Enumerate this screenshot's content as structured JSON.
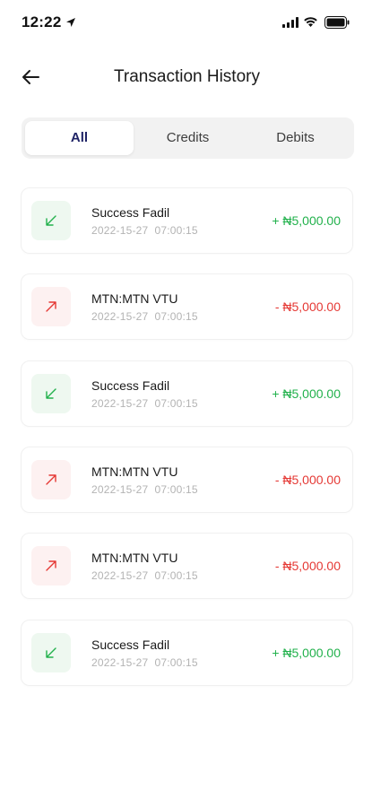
{
  "status_bar": {
    "time": "12:22",
    "icons": [
      "location-arrow-icon",
      "signal-icon",
      "wifi-icon",
      "battery-icon"
    ]
  },
  "header": {
    "back_icon": "arrow-left-icon",
    "title": "Transaction History"
  },
  "tabs": [
    {
      "label": "All",
      "active": true
    },
    {
      "label": "Credits",
      "active": false
    },
    {
      "label": "Debits",
      "active": false
    }
  ],
  "colors": {
    "credit": "#22b14c",
    "debit": "#e53935",
    "credit_bg": "#eef8f0",
    "debit_bg": "#fdf1f1",
    "active_tab_text": "#1f2366"
  },
  "transactions": [
    {
      "type": "credit",
      "icon": "arrow-down-left-icon",
      "name": "Success Fadil",
      "date": "2022-15-27  07:00:15",
      "amount": "+ ₦5,000.00"
    },
    {
      "type": "debit",
      "icon": "arrow-up-right-icon",
      "name": "MTN:MTN VTU",
      "date": "2022-15-27  07:00:15",
      "amount": "- ₦5,000.00"
    },
    {
      "type": "credit",
      "icon": "arrow-down-left-icon",
      "name": "Success Fadil",
      "date": "2022-15-27  07:00:15",
      "amount": "+ ₦5,000.00"
    },
    {
      "type": "debit",
      "icon": "arrow-up-right-icon",
      "name": "MTN:MTN VTU",
      "date": "2022-15-27  07:00:15",
      "amount": "- ₦5,000.00"
    },
    {
      "type": "debit",
      "icon": "arrow-up-right-icon",
      "name": "MTN:MTN VTU",
      "date": "2022-15-27  07:00:15",
      "amount": "- ₦5,000.00"
    },
    {
      "type": "credit",
      "icon": "arrow-down-left-icon",
      "name": "Success Fadil",
      "date": "2022-15-27  07:00:15",
      "amount": "+ ₦5,000.00"
    }
  ]
}
